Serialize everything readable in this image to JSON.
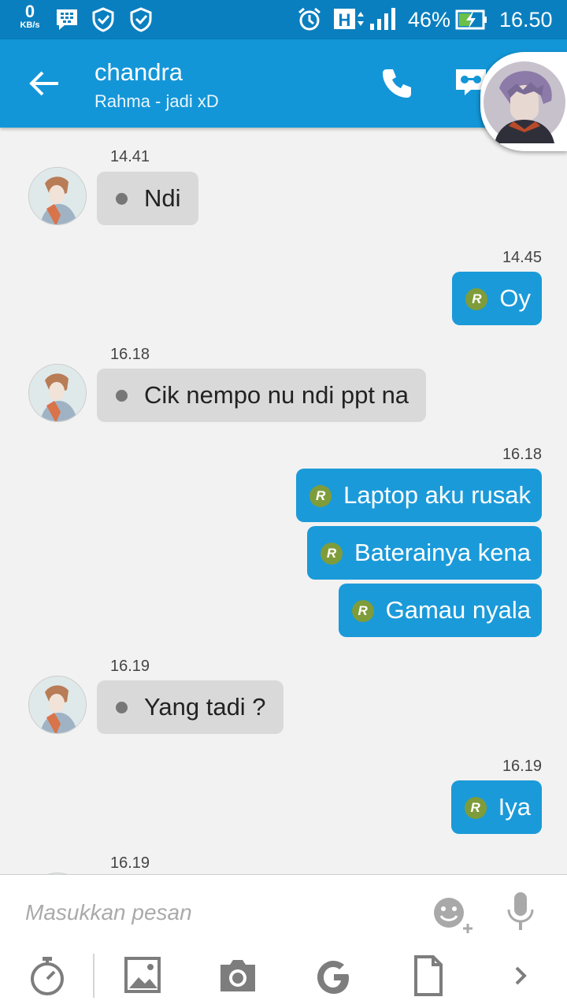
{
  "status_bar": {
    "speed_value": "0",
    "speed_unit": "KB/s",
    "battery_percent": "46%",
    "time": "16.50",
    "network_type": "H",
    "icons": [
      "bbm-notification-icon",
      "shield-check-icon",
      "shield-check-icon",
      "alarm-icon",
      "h-network-icon",
      "signal-icon",
      "battery-charging-icon"
    ]
  },
  "header": {
    "title": "chandra",
    "subtitle": "Rahma - jadi xD"
  },
  "messages": [
    {
      "side": "in",
      "time": "14.41",
      "text": "Ndi"
    },
    {
      "side": "out",
      "time": "14.45",
      "text": "Oy"
    },
    {
      "side": "in",
      "time": "16.18",
      "text": "Cik nempo nu ndi ppt na"
    },
    {
      "side": "out",
      "time": "16.18",
      "text": "Laptop aku rusak"
    },
    {
      "side": "out",
      "time": "",
      "text": "Baterainya kena"
    },
    {
      "side": "out",
      "time": "",
      "text": "Gamau nyala"
    },
    {
      "side": "in",
      "time": "16.19",
      "text": "Yang tadi ?"
    },
    {
      "side": "out",
      "time": "16.19",
      "text": "Iya"
    },
    {
      "side": "in",
      "time": "16.19",
      "text": ""
    }
  ],
  "read_mark": "R",
  "composer": {
    "placeholder": "Masukkan pesan"
  },
  "colors": {
    "status_bar": "#0a7fbf",
    "app_bar": "#1396d8",
    "outgoing_bubble": "#1b9ad9",
    "incoming_bubble": "#d9d9d9",
    "read_badge": "#7f9c3a"
  }
}
